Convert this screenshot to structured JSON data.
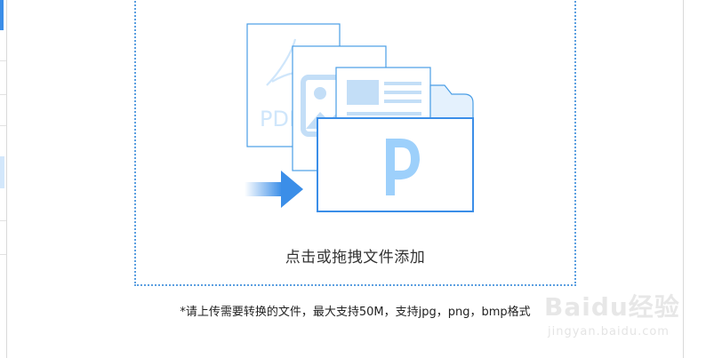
{
  "drop_zone": {
    "label": "点击或拖拽文件添加",
    "hint": "*请上传需要转换的文件，最大支持50M，支持jpg，png，bmp格式",
    "illustration": {
      "pdf_text": "PDF",
      "folder_logo_letter": "P"
    }
  },
  "watermark": {
    "brand": "Baidu经验",
    "url": "jingyan.baidu.com"
  },
  "colors": {
    "accent": "#3b8ee8",
    "light_blue": "#9dd0fb",
    "outline": "#4a9ee6",
    "dropzone_border": "#5b9fe0"
  },
  "icons": {
    "document_icon": "pdf-document-icon",
    "image_icon": "image-document-icon",
    "text_icon": "text-document-icon",
    "folder_icon": "folder-icon",
    "arrow_icon": "arrow-right-icon"
  }
}
